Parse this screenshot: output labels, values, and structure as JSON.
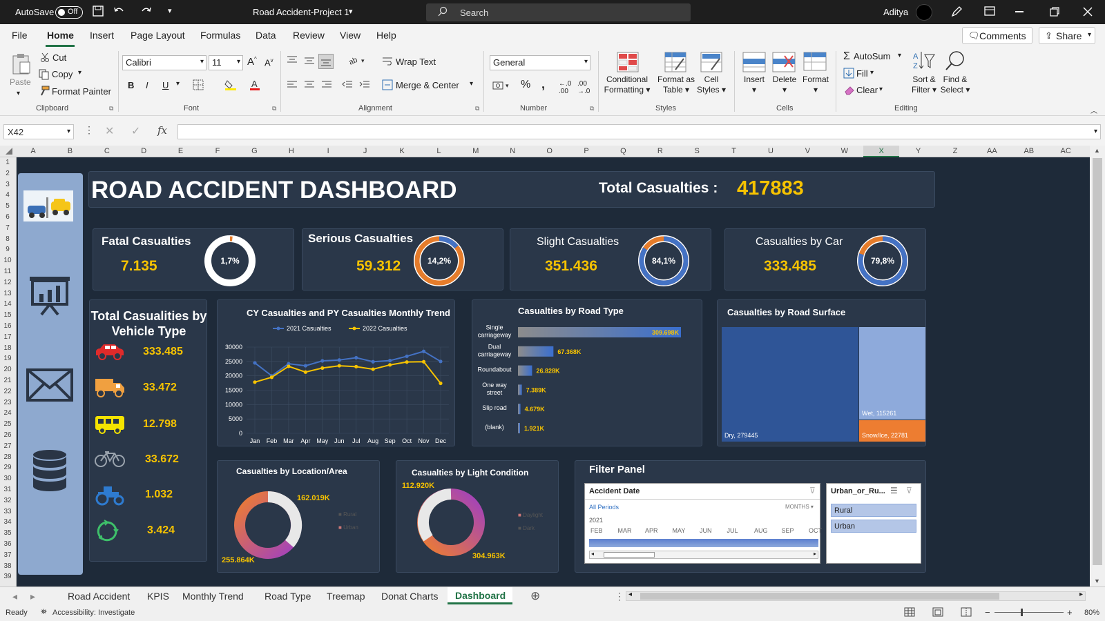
{
  "titlebar": {
    "autosave": "AutoSave",
    "toggle": "Off",
    "doc": "Road Accident-Project 1",
    "search": "Search",
    "user": "Aditya"
  },
  "menus": [
    "File",
    "Home",
    "Insert",
    "Page Layout",
    "Formulas",
    "Data",
    "Review",
    "View",
    "Help"
  ],
  "comments": "Comments",
  "share": "Share",
  "ribbon": {
    "paste": "Paste",
    "cut": "Cut",
    "copy": "Copy",
    "format_painter": "Format Painter",
    "clipboard": "Clipboard",
    "font_name": "Calibri",
    "font_size": "11",
    "font": "Font",
    "wrap": "Wrap Text",
    "merge": "Merge & Center",
    "alignment": "Alignment",
    "number_format": "General",
    "number": "Number",
    "cond": "Conditional",
    "cond2": "Formatting",
    "fmt_table": "Format as",
    "fmt_table2": "Table",
    "cell_styles": "Cell",
    "cell_styles2": "Styles",
    "styles": "Styles",
    "insert": "Insert",
    "delete": "Delete",
    "format": "Format",
    "cells": "Cells",
    "autosum": "AutoSum",
    "fill": "Fill",
    "clear": "Clear",
    "sort": "Sort &",
    "sort2": "Filter",
    "find": "Find &",
    "find2": "Select",
    "editing": "Editing"
  },
  "formula": {
    "namebox": "X42",
    "fx": "fx"
  },
  "columns": [
    "A",
    "B",
    "C",
    "D",
    "E",
    "F",
    "G",
    "H",
    "I",
    "J",
    "K",
    "L",
    "M",
    "N",
    "O",
    "P",
    "Q",
    "R",
    "S",
    "T",
    "U",
    "V",
    "W",
    "X",
    "Y",
    "Z",
    "AA",
    "AB",
    "AC"
  ],
  "rows": [
    "1",
    "2",
    "3",
    "4",
    "5",
    "6",
    "7",
    "8",
    "9",
    "10",
    "11",
    "12",
    "13",
    "14",
    "15",
    "16",
    "17",
    "18",
    "19",
    "20",
    "21",
    "22",
    "23",
    "24",
    "25",
    "26",
    "27",
    "28",
    "29",
    "30",
    "31",
    "32",
    "33",
    "34",
    "35",
    "36",
    "37",
    "38",
    "39"
  ],
  "dashboard": {
    "title": "ROAD ACCIDENT DASHBOARD",
    "total_label": "Total Casualties :",
    "total_value": "417883",
    "kpis": [
      {
        "label": "Fatal Casualties",
        "value": "7.135",
        "pct": "1,7%",
        "fraction": 0.017
      },
      {
        "label": "Serious Casualties",
        "value": "59.312",
        "pct": "14,2%",
        "fraction": 0.142
      },
      {
        "label": "Slight Casualties",
        "value": "351.436",
        "pct": "84,1%",
        "fraction": 0.841
      },
      {
        "label": "Casualties by Car",
        "value": "333.485",
        "pct": "79,8%",
        "fraction": 0.798
      }
    ],
    "vehicle": {
      "title1": "Total Casualities by",
      "title2": "Vehicle Type",
      "items": [
        {
          "icon": "car-icon",
          "value": "333.485"
        },
        {
          "icon": "truck-icon",
          "value": "33.472"
        },
        {
          "icon": "bus-icon",
          "value": "12.798"
        },
        {
          "icon": "bicycle-icon",
          "value": "33.672"
        },
        {
          "icon": "tractor-icon",
          "value": "1.032"
        },
        {
          "icon": "recycle-icon",
          "value": "3.424"
        }
      ]
    },
    "road_surface": {
      "title": "Casualties by Road Surface",
      "dry": "Dry, 279445",
      "wet": "Wet, 115261",
      "snow": "Snow/Ice, 22781"
    },
    "location": {
      "title": "Casualties by Location/Area",
      "urban_value": "255.864K",
      "rural_value": "162.019K",
      "legend": [
        "Rural",
        "Urban"
      ]
    },
    "light": {
      "title": "Casualties by Light Condition",
      "daylight_value": "304.963K",
      "dark_value": "112.920K",
      "legend": [
        "Daylight",
        "Dark"
      ]
    },
    "filter": {
      "title": "Filter Panel",
      "slicer_title": "Accident Date",
      "all_periods": "All Periods",
      "months": "MONTHS",
      "year": "2021",
      "months_list": [
        "FEB",
        "MAR",
        "APR",
        "MAY",
        "JUN",
        "JUL",
        "AUG",
        "SEP",
        "OCT"
      ],
      "area_title": "Urban_or_Ru...",
      "areas": [
        "Rural",
        "Urban"
      ]
    }
  },
  "chart_data": [
    {
      "type": "line",
      "title": "CY Casualties and PY Casualties Monthly Trend",
      "categories": [
        "Jan",
        "Feb",
        "Mar",
        "Apr",
        "May",
        "Jun",
        "Jul",
        "Aug",
        "Sep",
        "Oct",
        "Nov",
        "Dec"
      ],
      "ylim": [
        0,
        30000
      ],
      "yticks": [
        "0",
        "5000",
        "10000",
        "15000",
        "20000",
        "25000",
        "30000"
      ],
      "series": [
        {
          "name": "2021 Casualties",
          "color": "#4472c4",
          "values": [
            24500,
            20000,
            24200,
            23500,
            25200,
            25500,
            26300,
            24900,
            25300,
            26800,
            28500,
            25000
          ]
        },
        {
          "name": "2022 Casualties",
          "color": "#f7c300",
          "values": [
            17800,
            19500,
            23300,
            21300,
            22700,
            23500,
            23200,
            22300,
            23800,
            24800,
            24900,
            17400
          ]
        }
      ]
    },
    {
      "type": "bar",
      "title": "Casualties by Road Type",
      "categories": [
        "Single carriageway",
        "Dual carriageway",
        "Roundabout",
        "One way street",
        "Slip road",
        "(blank)"
      ],
      "values": [
        309698,
        67368,
        26828,
        7389,
        4679,
        1921
      ],
      "labels": [
        "309.698K",
        "67.368K",
        "26.828K",
        "7.389K",
        "4.679K",
        "1.921K"
      ]
    }
  ]
}
